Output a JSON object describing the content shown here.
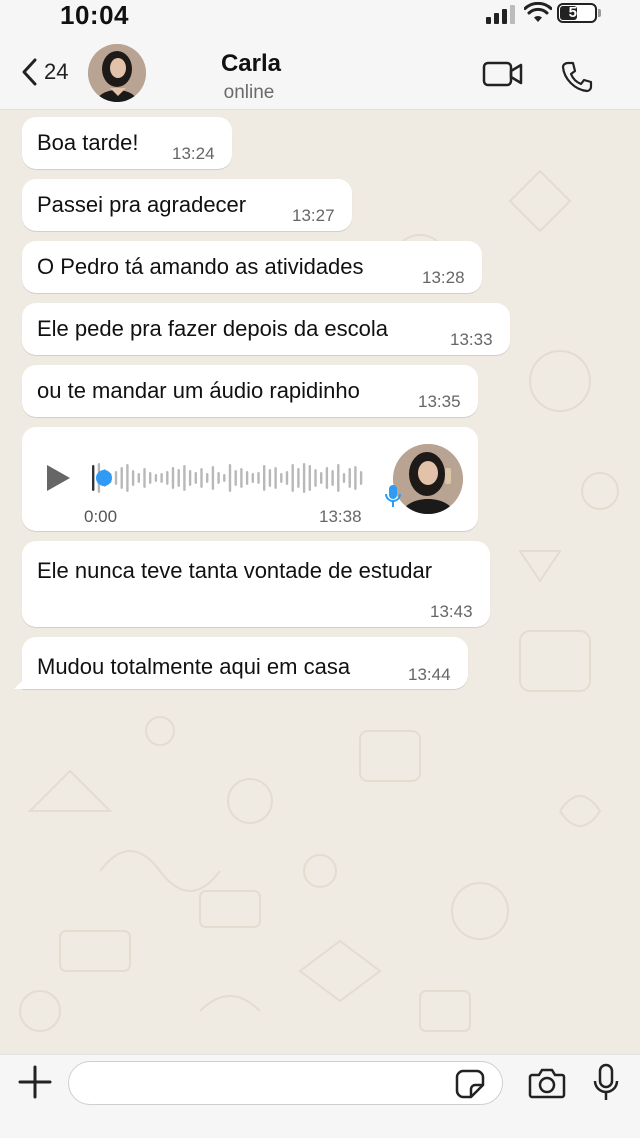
{
  "status_bar": {
    "time": "10:04",
    "battery": "50",
    "battery_level": 0.5
  },
  "header": {
    "back_count": "24",
    "contact_name": "Carla",
    "contact_status": "online",
    "icons": [
      "chevron-left-icon",
      "video-camera-icon",
      "phone-icon"
    ]
  },
  "messages": [
    {
      "text": "Boa tarde!",
      "time": "13:24"
    },
    {
      "text": "Passei pra agradecer",
      "time": "13:27"
    },
    {
      "text": "O Pedro tá amando as atividades",
      "time": "13:28"
    },
    {
      "text": "Ele pede pra fazer depois da escola",
      "time": "13:33"
    },
    {
      "text": "ou te mandar um áudio rapidinho",
      "time": "13:35"
    },
    {
      "text": "Ele nunca teve tanta vontade de estudar",
      "time": "13:43"
    },
    {
      "text": "Mudou totalmente aqui em casa",
      "time": "13:44"
    }
  ],
  "audio_message": {
    "duration": "0:00",
    "time": "13:38",
    "progress": 0
  },
  "input_bar": {
    "placeholder": "",
    "icons": [
      "plus-icon",
      "sticker-icon",
      "camera-icon",
      "microphone-icon"
    ]
  },
  "colors": {
    "chat_background": "#efeae2",
    "bubble": "#ffffff",
    "bar_background": "#f6f6f6",
    "audio_accent": "#2f9bf5"
  }
}
